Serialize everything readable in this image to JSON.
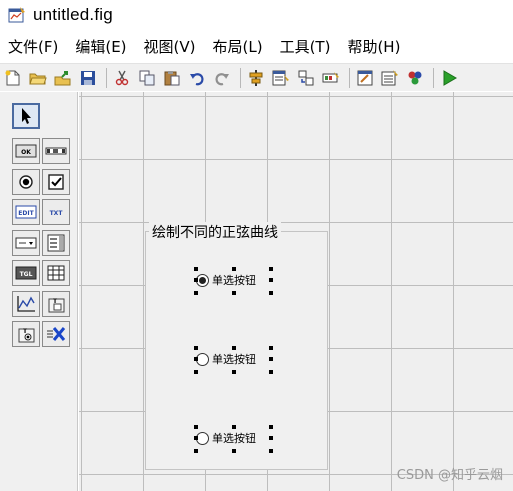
{
  "window": {
    "title": "untitled.fig"
  },
  "menu": [
    "文件(F)",
    "编辑(E)",
    "视图(V)",
    "布局(L)",
    "工具(T)",
    "帮助(H)"
  ],
  "toolbar": {
    "buttons": [
      "new-file",
      "open-folder",
      "export",
      "save",
      "cut",
      "copy",
      "paste",
      "undo",
      "redo",
      "align-objects",
      "menu-editor",
      "tab-order-editor",
      "toolbar-editor",
      "editor",
      "property-inspector",
      "object-browser",
      "run"
    ]
  },
  "palette": {
    "items": [
      "select-pointer",
      "push-button",
      "slider",
      "radio-button",
      "check-box",
      "edit-text",
      "static-text",
      "popup-menu",
      "list-box",
      "toggle-button",
      "table",
      "axes",
      "panel",
      "button-group",
      "activex-control"
    ]
  },
  "panel": {
    "title": "绘制不同的正弦曲线",
    "radios": [
      {
        "label": "单选按钮",
        "selected": true
      },
      {
        "label": "单选按钮",
        "selected": false
      },
      {
        "label": "单选按钮",
        "selected": false
      }
    ]
  },
  "watermark": "CSDN @知乎云烟",
  "colors": {
    "grid": "#bdbdbd",
    "canvas": "#efefef",
    "run": "#2aa02a",
    "accent": "#1a46c8"
  }
}
